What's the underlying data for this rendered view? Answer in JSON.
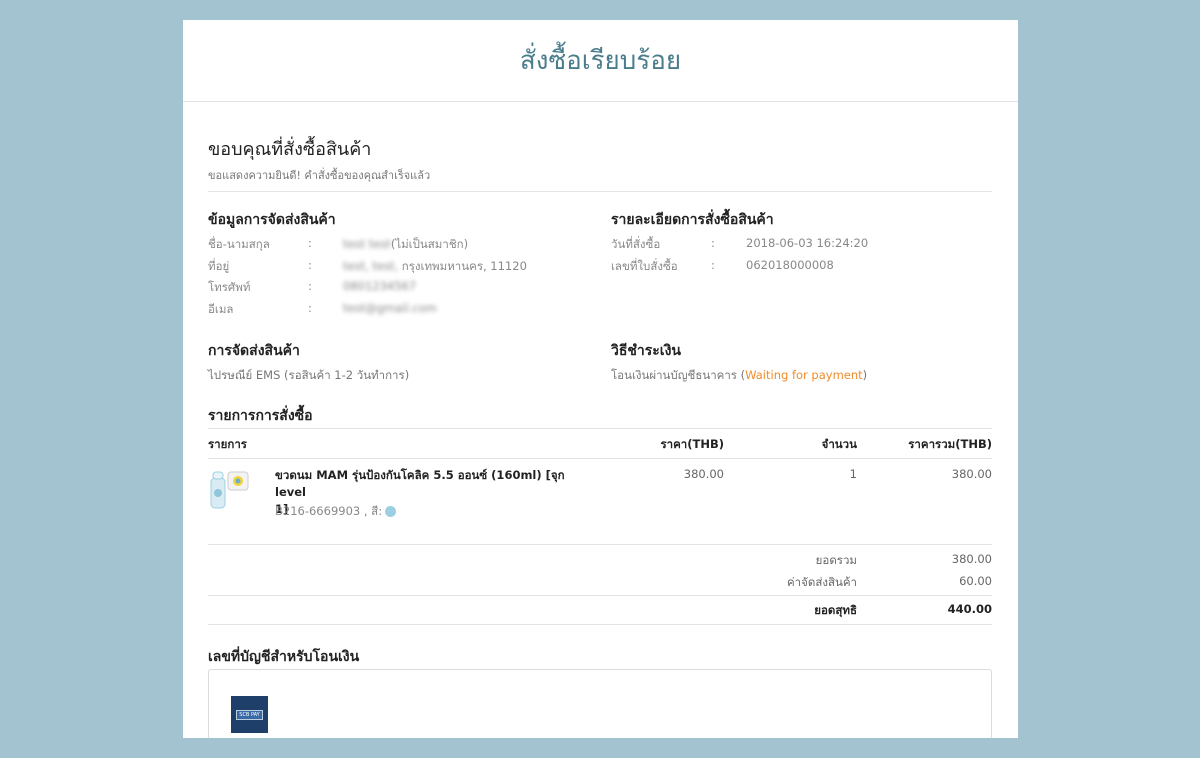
{
  "header": {
    "title": "สั่งซื้อเรียบร้อย"
  },
  "thanks": {
    "title": "ขอบคุณที่สั่งซื้อสินค้า",
    "subtitle": "ขอแสดงความยินดี! คำสั่งซื้อของคุณสำเร็จแล้ว"
  },
  "shipping_info": {
    "title": "ข้อมูลการจัดส่งสินค้า",
    "rows": [
      {
        "key": "ชื่อ-นามสกุล",
        "blurred": "test test",
        "value": "(ไม่เป็นสมาชิก)"
      },
      {
        "key": "ที่อยู่",
        "blurred": "test, test,",
        "value": " กรุงเทพมหานคร, 11120"
      },
      {
        "key": "โทรศัพท์",
        "blurred": "0801234567",
        "value": ""
      },
      {
        "key": "อีเมล",
        "blurred": "test@gmail.com",
        "value": ""
      }
    ],
    "colon": ":"
  },
  "order_details": {
    "title": "รายละเอียดการสั่งซื้อสินค้า",
    "rows": [
      {
        "key": "วันที่สั่งซื้อ",
        "value": "2018-06-03 16:24:20"
      },
      {
        "key": "เลขที่ใบสั่งซื้อ",
        "value": "062018000008"
      }
    ]
  },
  "delivery": {
    "title": "การจัดส่งสินค้า",
    "value": "ไปรษณีย์ EMS (รอสินค้า 1-2 วันทำการ)"
  },
  "payment": {
    "title": "วิธีชำระเงิน",
    "method": "โอนเงินผ่านบัญชีธนาคาร (",
    "status": "Waiting for payment",
    "close": ")"
  },
  "order_list": {
    "title": "รายการการสั่งซื้อ",
    "columns": {
      "item": "รายการ",
      "price": "ราคา(THB)",
      "qty": "จำนวน",
      "total": "ราคารวม(THB)"
    },
    "items": [
      {
        "name_line1": "ขวดนม MAM รุ่นป้องกันโคลิค 5.5 ออนซ์ (160ml) [จุก level",
        "name_line2": "1]",
        "sku": "B216-6669903 , สี:",
        "price": "380.00",
        "qty": "1",
        "total": "380.00",
        "color": "#9ccfe0"
      }
    ],
    "summary": {
      "subtotal_label": "ยอดรวม",
      "subtotal": "380.00",
      "shipping_label": "ค่าจัดส่งสินค้า",
      "shipping": "60.00",
      "net_label": "ยอดสุทธิ",
      "net": "440.00"
    }
  },
  "bank": {
    "title": "เลขที่บัญชีสำหรับโอนเงิน",
    "logo_text": "SCB PAY"
  }
}
